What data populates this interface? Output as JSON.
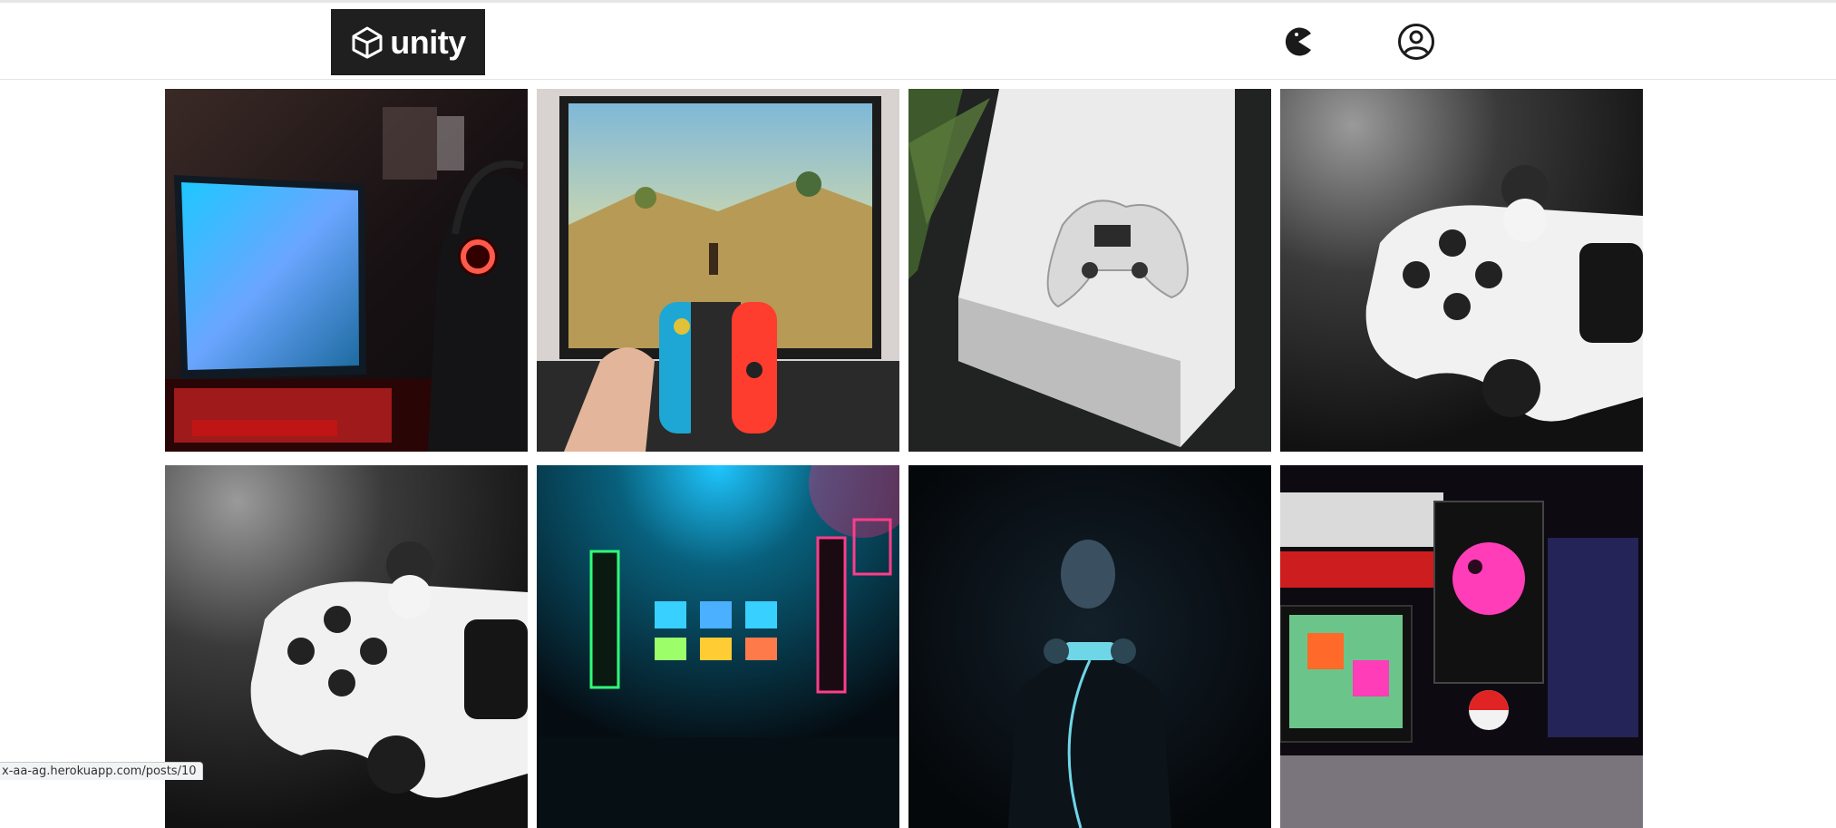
{
  "header": {
    "logo_text": "unity",
    "icons": [
      "unity-logo-icon",
      "pacman-icon",
      "user-account-icon"
    ]
  },
  "gallery": {
    "items": [
      {
        "subject": "gaming-setup-red-headset-photo"
      },
      {
        "subject": "nintendo-switch-joycon-tv-photo"
      },
      {
        "subject": "white-console-controller-photo"
      },
      {
        "subject": "white-controller-closeup-photo"
      },
      {
        "subject": "white-controller-closeup-photo"
      },
      {
        "subject": "neon-arcade-room-photo"
      },
      {
        "subject": "dark-gamer-controller-photo"
      },
      {
        "subject": "pixel-display-game-over-photo"
      }
    ]
  },
  "status": {
    "url": "x-aa-ag.herokuapp.com/posts/10"
  },
  "colors": {
    "navbar_bg": "#ffffff",
    "logo_bg": "#1f1f1f",
    "logo_fg": "#ffffff",
    "icon": "#1a1a1a",
    "divider": "#e3e3e3"
  }
}
